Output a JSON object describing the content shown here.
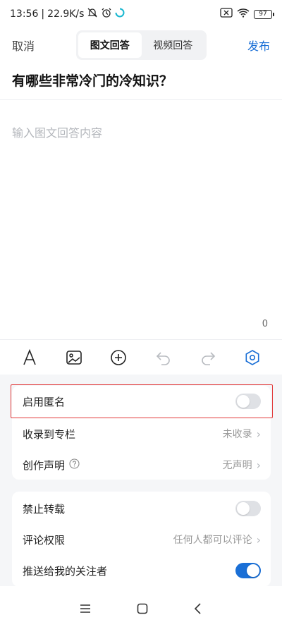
{
  "status": {
    "time": "13:56",
    "speed": "22.9K/s",
    "battery": "97",
    "icons": [
      "mute-icon",
      "alarm-icon",
      "loading-icon",
      "sim-off-icon",
      "wifi-icon",
      "battery-icon"
    ]
  },
  "topbar": {
    "cancel": "取消",
    "tabs": [
      {
        "label": "图文回答",
        "active": true
      },
      {
        "label": "视频回答",
        "active": false
      }
    ],
    "publish": "发布"
  },
  "question": "有哪些非常冷门的冷知识？",
  "editor": {
    "placeholder": "输入图文回答内容",
    "char_count": "0"
  },
  "toolbar": {
    "icons": [
      "text-format-icon",
      "image-icon",
      "add-circle-icon",
      "undo-icon",
      "redo-icon",
      "settings-hexagon-icon"
    ]
  },
  "settings": {
    "group1": [
      {
        "label": "启用匿名",
        "type": "switch",
        "on": false
      },
      {
        "label": "收录到专栏",
        "type": "link",
        "value": "未收录"
      },
      {
        "label": "创作声明",
        "type": "link",
        "value": "无声明",
        "help": true
      }
    ],
    "group2": [
      {
        "label": "禁止转载",
        "type": "switch",
        "on": false
      },
      {
        "label": "评论权限",
        "type": "link",
        "value": "任何人都可以评论"
      },
      {
        "label": "推送给我的关注者",
        "type": "switch",
        "on": true
      }
    ]
  },
  "colors": {
    "accent": "#1a6fd6",
    "highlight": "#e23a3a",
    "placeholder": "#b3b6bb"
  }
}
